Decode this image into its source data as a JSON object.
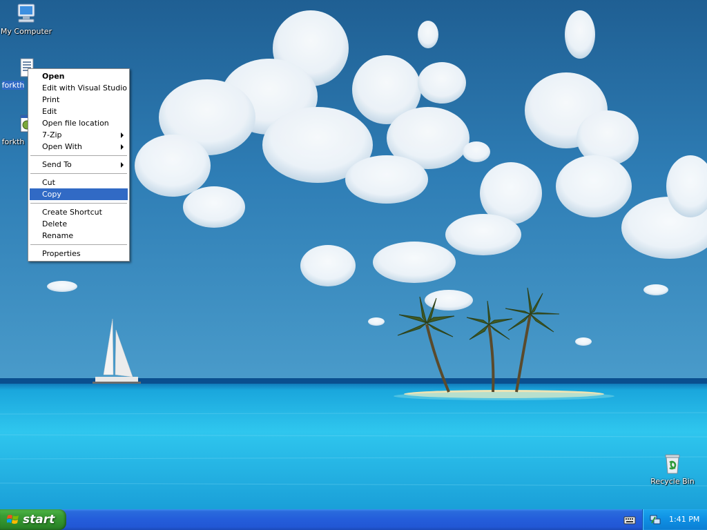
{
  "desktop": {
    "icons": [
      {
        "label": "My Computer",
        "icon": "my-computer-icon"
      },
      {
        "label": "forkth",
        "icon": "document-file-icon",
        "selected": true
      },
      {
        "label": "forkth",
        "icon": "executable-icon"
      },
      {
        "label": "Recycle Bin",
        "icon": "recycle-bin-icon"
      }
    ]
  },
  "context_menu": {
    "items": [
      {
        "label": "Open",
        "default": true
      },
      {
        "label": "Edit with Visual Studio"
      },
      {
        "label": "Print"
      },
      {
        "label": "Edit"
      },
      {
        "label": "Open file location"
      },
      {
        "label": "7-Zip",
        "submenu": true
      },
      {
        "label": "Open With",
        "submenu": true
      },
      {
        "label": "Send To",
        "submenu": true
      },
      {
        "label": "Cut"
      },
      {
        "label": "Copy",
        "highlighted": true
      },
      {
        "label": "Create Shortcut"
      },
      {
        "label": "Delete"
      },
      {
        "label": "Rename"
      },
      {
        "label": "Properties"
      }
    ]
  },
  "taskbar": {
    "start_label": "start",
    "clock": "1:41 PM"
  },
  "colors": {
    "menu_highlight": "#316ac5",
    "taskbar_blue": "#245edb",
    "start_green": "#3a9d35",
    "tray_blue": "#0f91e4"
  }
}
